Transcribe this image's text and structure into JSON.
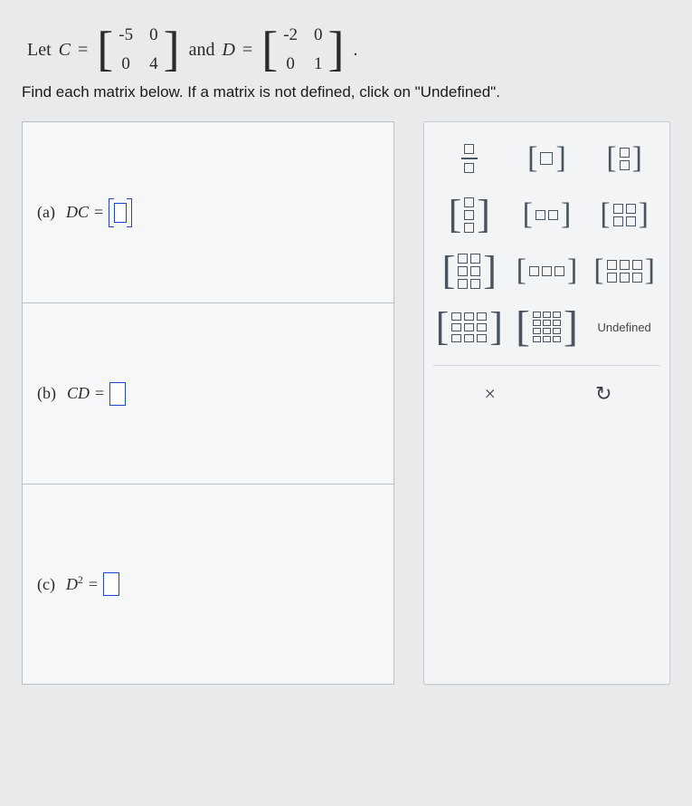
{
  "problem": {
    "let": "Let",
    "c_label": "C",
    "eq": "=",
    "and": "and",
    "d_label": "D",
    "matrix_c": [
      "-5",
      "0",
      "0",
      "4"
    ],
    "matrix_d": [
      "-2",
      "0",
      "0",
      "1"
    ],
    "dot": "."
  },
  "instruction": "Find each matrix below. If a matrix is not defined, click on \"Undefined\".",
  "parts": {
    "a": {
      "tag": "(a)",
      "expr": "DC",
      "eq": " = "
    },
    "b": {
      "tag": "(b)",
      "expr": "CD",
      "eq": " = "
    },
    "c": {
      "tag": "(c)",
      "expr_base": "D",
      "expr_exp": "2",
      "eq": " = "
    }
  },
  "panel": {
    "undefined_label": "Undefined",
    "close_label": "×",
    "reset_label": "↺"
  }
}
